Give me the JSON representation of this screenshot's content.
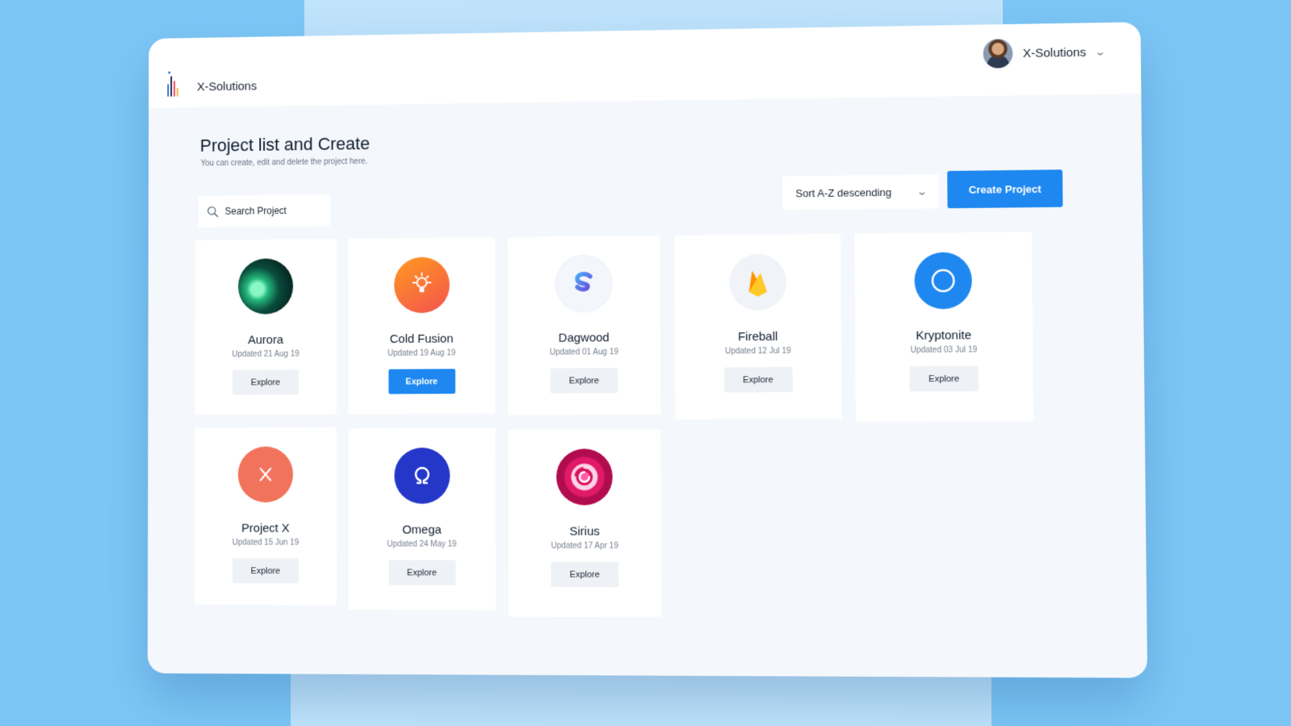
{
  "app": {
    "brand": "X-Solutions",
    "user_name": "X-Solutions"
  },
  "page": {
    "title": "Project list and Create",
    "subtitle": "You can create, edit and delete the project here."
  },
  "search": {
    "label": "Search Project"
  },
  "sort": {
    "selected": "Sort A-Z descending"
  },
  "actions": {
    "create_label": "Create Project"
  },
  "projects": [
    {
      "name": "Aurora",
      "updated": "Updated 21 Aug 19",
      "explore": "Explore",
      "icon": "aurora-icon"
    },
    {
      "name": "Cold Fusion",
      "updated": "Updated 19 Aug 19",
      "explore": "Explore",
      "icon": "lightbulb-icon"
    },
    {
      "name": "Dagwood",
      "updated": "Updated 01 Aug 19",
      "explore": "Explore",
      "icon": "letter-s-icon"
    },
    {
      "name": "Fireball",
      "updated": "Updated 12 Jul 19",
      "explore": "Explore",
      "icon": "flame-icon"
    },
    {
      "name": "Kryptonite",
      "updated": "Updated 03 Jul 19",
      "explore": "Explore",
      "icon": "ring-icon"
    },
    {
      "name": "Project X",
      "updated": "Updated 15 Jun 19",
      "explore": "Explore",
      "icon": "x-icon"
    },
    {
      "name": "Omega",
      "updated": "Updated 24 May 19",
      "explore": "Explore",
      "icon": "omega-icon"
    },
    {
      "name": "Sirius",
      "updated": "Updated 17 Apr 19",
      "explore": "Explore",
      "icon": "swirl-icon"
    }
  ],
  "colors": {
    "accent": "#1e88f0",
    "background": "#7cc6f6"
  }
}
